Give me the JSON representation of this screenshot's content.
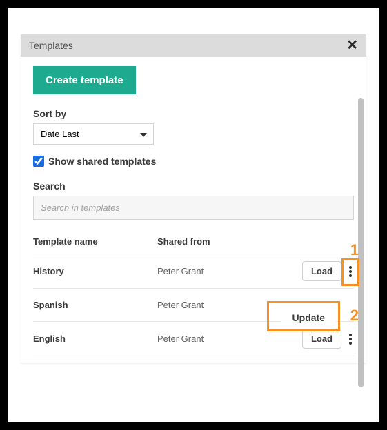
{
  "header": {
    "title": "Templates",
    "close": "✕"
  },
  "actions": {
    "create": "Create template"
  },
  "sort": {
    "label": "Sort by",
    "value": "Date Last"
  },
  "show_shared": {
    "label": "Show shared templates",
    "checked": true
  },
  "search": {
    "label": "Search",
    "placeholder": "Search in templates"
  },
  "table": {
    "headers": {
      "name": "Template name",
      "shared": "Shared from"
    },
    "load_label": "Load",
    "rows": [
      {
        "name": "History",
        "shared": "Peter Grant"
      },
      {
        "name": "Spanish",
        "shared": "Peter Grant"
      },
      {
        "name": "English",
        "shared": "Peter Grant"
      }
    ]
  },
  "popup": {
    "update": "Update"
  },
  "annotations": {
    "one": "1",
    "two": "2"
  }
}
